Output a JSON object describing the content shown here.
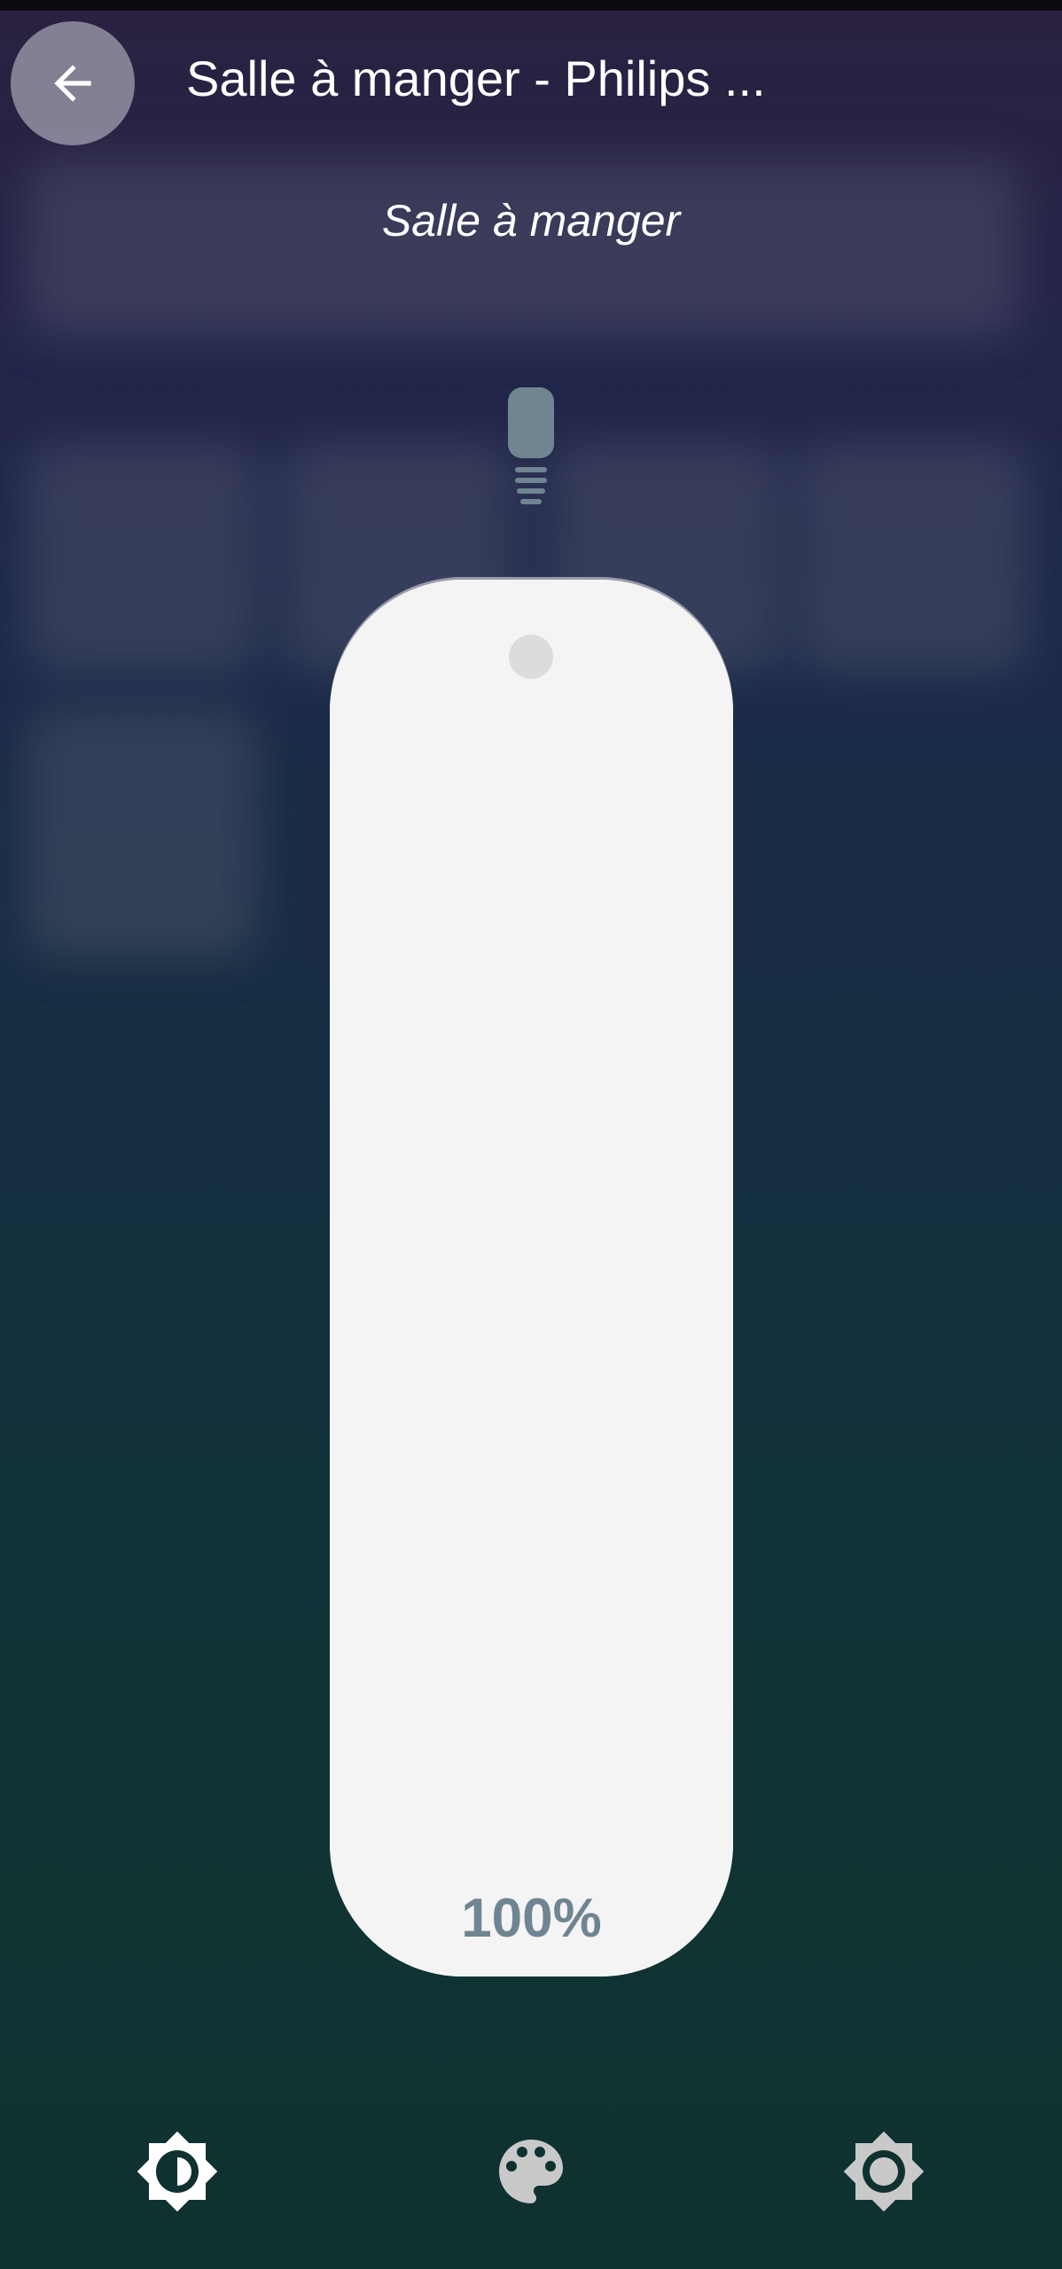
{
  "header": {
    "title": "Salle à manger - Philips ...",
    "back_icon": "arrow-left-icon"
  },
  "subtitle": "Salle à manger",
  "device_icon": "light-bulb-icon",
  "brightness": {
    "value_label": "100%",
    "level_fraction": 1.0
  },
  "bottom_tabs": [
    {
      "icon": "brightness-icon",
      "active": true
    },
    {
      "icon": "palette-icon",
      "active": false
    },
    {
      "icon": "settings-icon",
      "active": false
    }
  ],
  "colors": {
    "slider": "#f4f4f4",
    "value_text": "#6f8591",
    "icon_active": "#ffffff",
    "icon_inactive": "#c9c9c9"
  }
}
